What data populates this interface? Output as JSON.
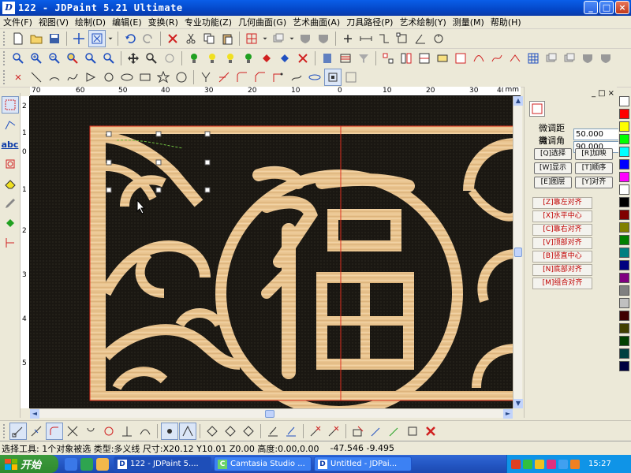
{
  "window": {
    "title": "122 - JDPaint 5.21 Ultimate",
    "app_icon_letter": "D",
    "buttons": {
      "minimize": "_",
      "maximize": "□",
      "close": "×"
    }
  },
  "menu": [
    "文件(F)",
    "视图(V)",
    "绘制(D)",
    "编辑(E)",
    "变换(R)",
    "专业功能(Z)",
    "几何曲面(G)",
    "艺术曲面(A)",
    "刀具路径(P)",
    "艺术绘制(Y)",
    "测量(M)",
    "帮助(H)"
  ],
  "ruler": {
    "unit": "mm",
    "h_ticks": [
      "70",
      "60",
      "50",
      "40",
      "30",
      "20",
      "10",
      "0",
      "10",
      "20",
      "30",
      "40"
    ],
    "v_ticks": [
      "2",
      "1",
      "0",
      "1",
      "2",
      "3",
      "4",
      "5"
    ]
  },
  "panel": {
    "fine_distance_label": "微调距离",
    "fine_distance_value": "50.000",
    "fine_angle_label": "微调角度",
    "fine_angle_value": "90.000",
    "buttons": [
      "[Q]选择",
      "[R]加映",
      "[W]显示",
      "[T]顺序",
      "[E]图层",
      "[Y]对齐"
    ],
    "align_buttons": [
      "[Z]靠左对齐",
      "[X]水平中心",
      "[C]靠右对齐",
      "[V]顶部对齐",
      "[B]竖直中心",
      "[N]底部对齐",
      "[M]组合对齐"
    ]
  },
  "palette": [
    "#ffffff",
    "#ff0000",
    "#ffff00",
    "#00ff00",
    "#00ffff",
    "#0000ff",
    "#ff00ff",
    "#ffffff",
    "#000000",
    "#800000",
    "#808000",
    "#008000",
    "#008080",
    "#000080",
    "#800080",
    "#808080",
    "#c0c0c0",
    "#400000",
    "#404000",
    "#004000",
    "#004040",
    "#000040"
  ],
  "status": {
    "main": "选择工具: 1个对象被选 类型:多义线 尺寸:X20.12 Y10.01 Z0.00 高度:0.00,0.00",
    "coords": "-47.546 -9.495"
  },
  "taskbar": {
    "start": "开始",
    "tasks": [
      "122 - JDPaint 5....",
      "Camtasia Studio ...",
      "Untitled - JDPai..."
    ],
    "clock": "15:27"
  },
  "colors": {
    "canvas_bg": "#1a1712",
    "wood": "#e9c48f",
    "selection_border": "#e03020"
  }
}
